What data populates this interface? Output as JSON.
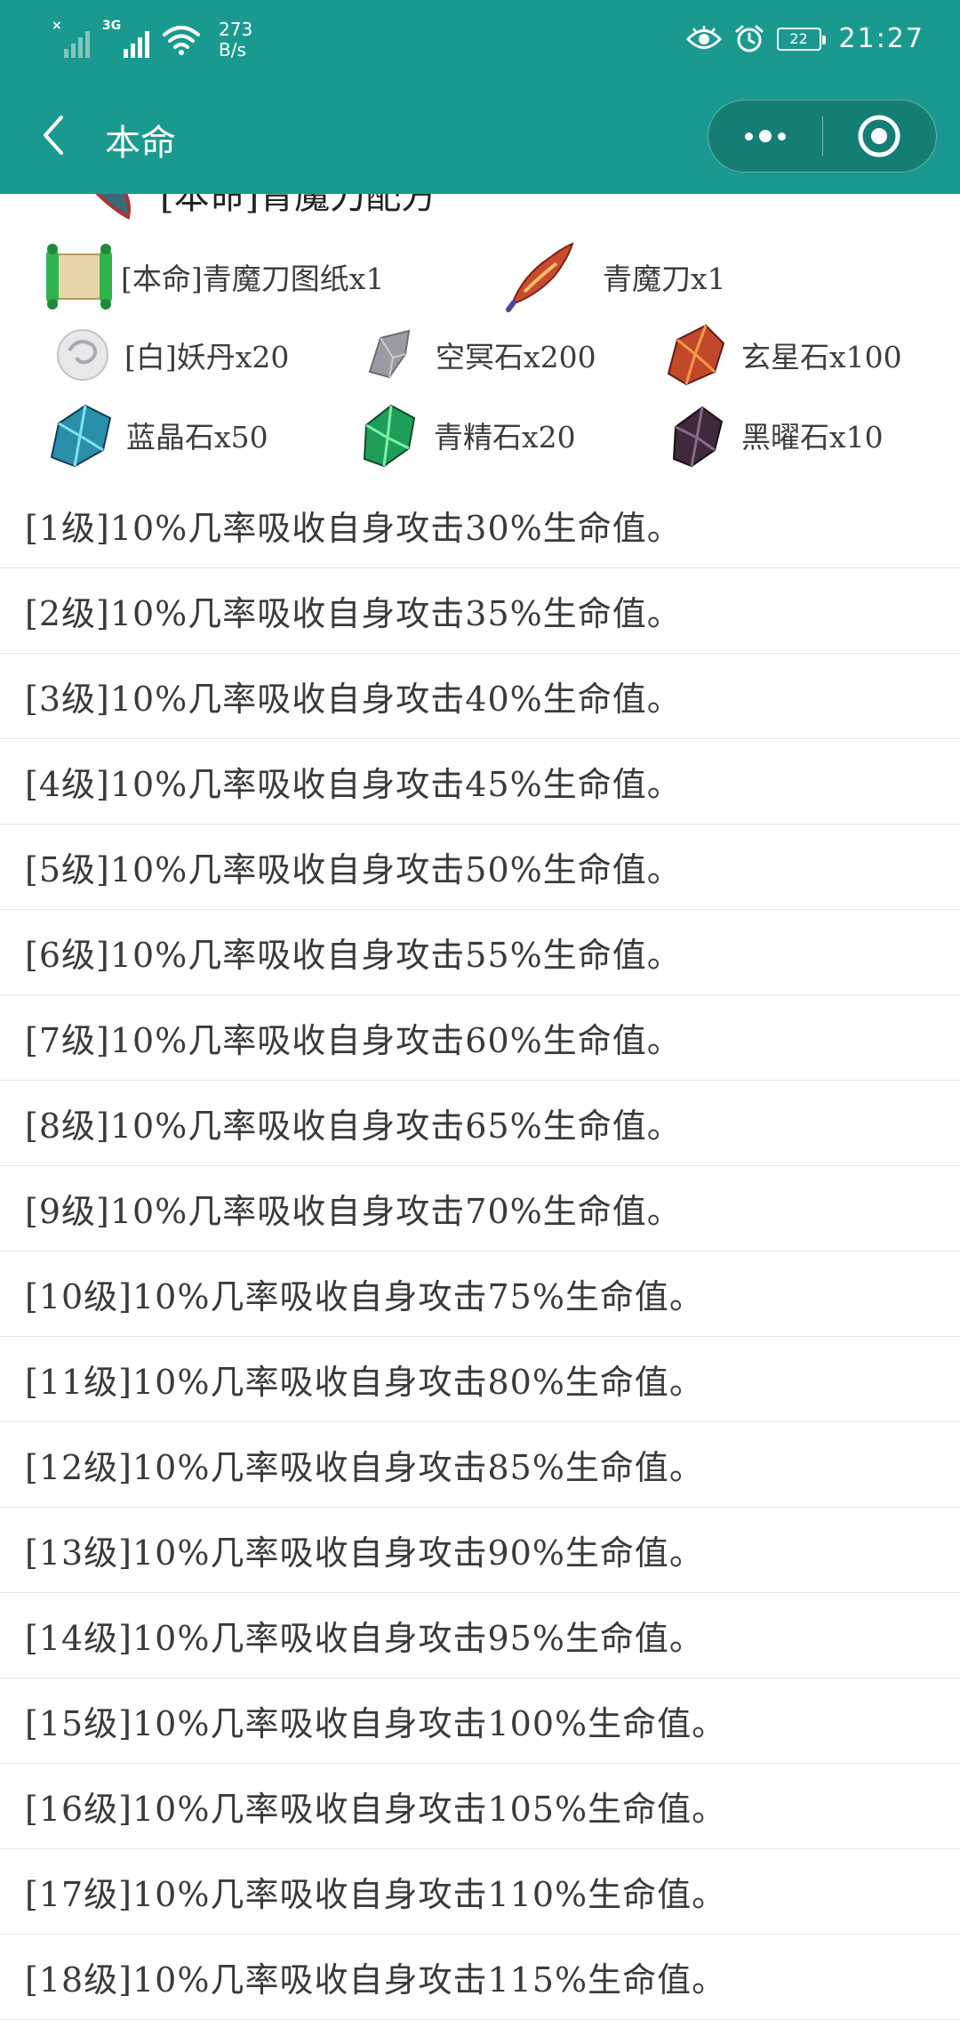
{
  "status_bar": {
    "network_tag": "3G",
    "net_speed_value": "273",
    "net_speed_unit": "B/s",
    "battery": "22",
    "time": "21:27",
    "icons": [
      "no-signal-icon",
      "signal-icon",
      "wifi-icon",
      "eye-icon",
      "alarm-icon",
      "battery-icon"
    ]
  },
  "navbar": {
    "title": "本命",
    "back_icon": "chevron-left-icon",
    "more_icon": "more-dots-icon",
    "close_icon": "target-circle-icon"
  },
  "partial_heading": {
    "text": "[本命]青魔刀配方"
  },
  "materials": [
    {
      "label": "[本命]青魔刀图纸x1",
      "icon": "scroll-icon"
    },
    {
      "label": "青魔刀x1",
      "icon": "blade-icon"
    },
    {
      "label": "[白]妖丹x20",
      "icon": "white-pill-icon"
    },
    {
      "label": "空冥石x200",
      "icon": "grey-stone-icon"
    },
    {
      "label": "玄星石x100",
      "icon": "red-crystal-icon"
    },
    {
      "label": "蓝晶石x50",
      "icon": "blue-crystal-icon"
    },
    {
      "label": "青精石x20",
      "icon": "green-crystal-icon"
    },
    {
      "label": "黑曜石x10",
      "icon": "dark-crystal-icon"
    }
  ],
  "levels": [
    "[1级]10%几率吸收自身攻击30%生命值。",
    "[2级]10%几率吸收自身攻击35%生命值。",
    "[3级]10%几率吸收自身攻击40%生命值。",
    "[4级]10%几率吸收自身攻击45%生命值。",
    "[5级]10%几率吸收自身攻击50%生命值。",
    "[6级]10%几率吸收自身攻击55%生命值。",
    "[7级]10%几率吸收自身攻击60%生命值。",
    "[8级]10%几率吸收自身攻击65%生命值。",
    "[9级]10%几率吸收自身攻击70%生命值。",
    "[10级]10%几率吸收自身攻击75%生命值。",
    "[11级]10%几率吸收自身攻击80%生命值。",
    "[12级]10%几率吸收自身攻击85%生命值。",
    "[13级]10%几率吸收自身攻击90%生命值。",
    "[14级]10%几率吸收自身攻击95%生命值。",
    "[15级]10%几率吸收自身攻击100%生命值。",
    "[16级]10%几率吸收自身攻击105%生命值。",
    "[17级]10%几率吸收自身攻击110%生命值。",
    "[18级]10%几率吸收自身攻击115%生命值。"
  ],
  "colors": {
    "header": "#1a9a8e",
    "text": "#3a3a3a",
    "divider": "#e4e4e4"
  }
}
